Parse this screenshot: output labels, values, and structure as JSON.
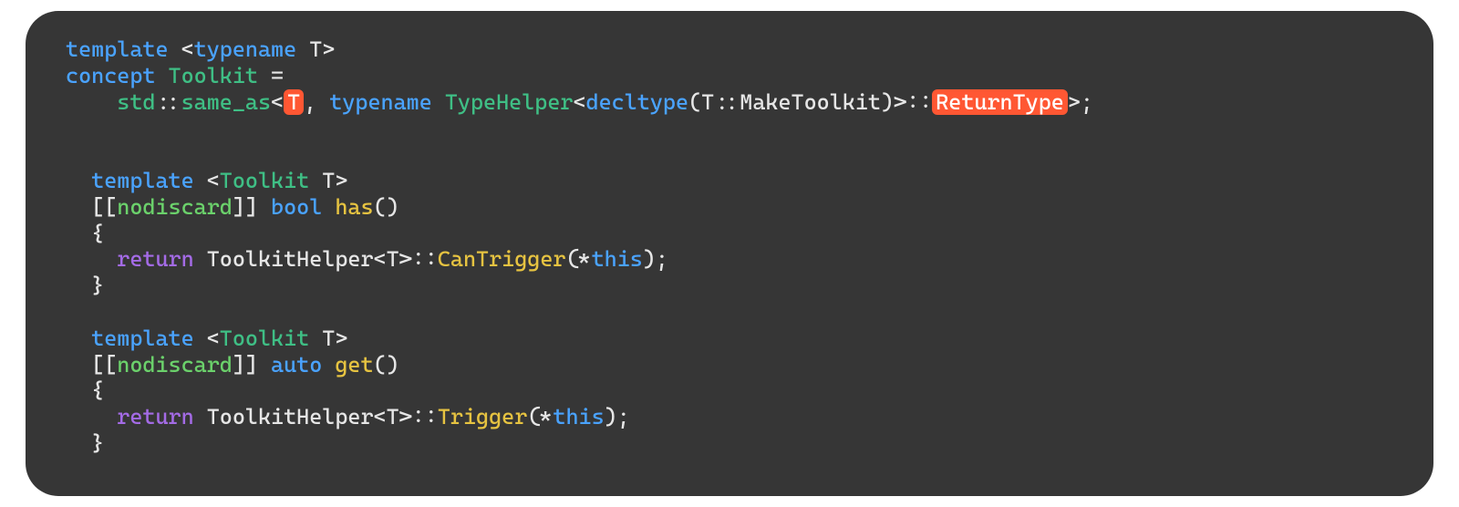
{
  "code": {
    "line1": {
      "template": "template",
      "lt": " <",
      "typename": "typename",
      "T": " T",
      "gt": ">"
    },
    "line2": {
      "concept": "concept",
      "Toolkit": " Toolkit",
      "eq": " ="
    },
    "line3": {
      "indent": "    ",
      "std": "std",
      "scope1": "::",
      "same_as": "same_as",
      "lt": "<",
      "T_hl": "T",
      "comma": ", ",
      "typename": "typename",
      "sp": " ",
      "TypeHelper": "TypeHelper",
      "lt2": "<",
      "decltype": "decltype",
      "lp": "(",
      "T2": "T",
      "scope2": "::",
      "MakeToolkit": "MakeToolkit",
      "rp": ")",
      "gt2": ">",
      "scope3": "::",
      "ReturnType_hl": "ReturnType",
      "gt": ">",
      "semi": ";"
    },
    "line5": {
      "indent": "  ",
      "template": "template",
      "lt": " <",
      "Toolkit": "Toolkit",
      "T": " T",
      "gt": ">"
    },
    "line6": {
      "indent": "  ",
      "attr": "[[",
      "nodiscard": "nodiscard",
      "attr2": "]]",
      "sp": " ",
      "bool": "bool",
      "sp2": " ",
      "has": "has",
      "parens": "()"
    },
    "line7": {
      "indent": "  ",
      "brace": "{"
    },
    "line8": {
      "indent": "    ",
      "return": "return",
      "sp": " ",
      "ToolkitHelper": "ToolkitHelper",
      "lt": "<",
      "T": "T",
      "gt": ">",
      "scope": "::",
      "CanTrigger": "CanTrigger",
      "lp": "(",
      "star": "*",
      "this": "this",
      "rp": ")",
      "semi": ";"
    },
    "line9": {
      "indent": "  ",
      "brace": "}"
    },
    "line11": {
      "indent": "  ",
      "template": "template",
      "lt": " <",
      "Toolkit": "Toolkit",
      "T": " T",
      "gt": ">"
    },
    "line12": {
      "indent": "  ",
      "attr": "[[",
      "nodiscard": "nodiscard",
      "attr2": "]]",
      "sp": " ",
      "auto": "auto",
      "sp2": " ",
      "get": "get",
      "parens": "()"
    },
    "line13": {
      "indent": "  ",
      "brace": "{"
    },
    "line14": {
      "indent": "    ",
      "return": "return",
      "sp": " ",
      "ToolkitHelper": "ToolkitHelper",
      "lt": "<",
      "T": "T",
      "gt": ">",
      "scope": "::",
      "Trigger": "Trigger",
      "lp": "(",
      "star": "*",
      "this": "this",
      "rp": ")",
      "semi": ";"
    },
    "line15": {
      "indent": "  ",
      "brace": "}"
    }
  }
}
